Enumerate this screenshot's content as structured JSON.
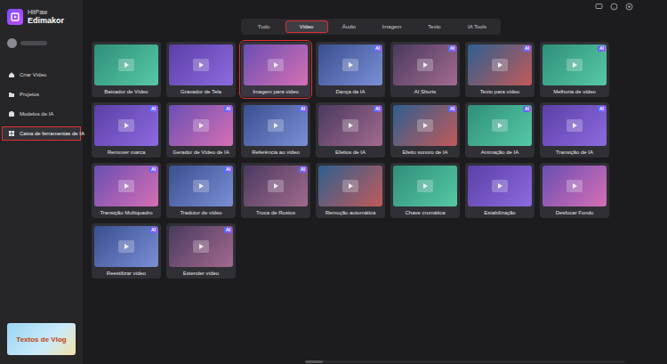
{
  "app": {
    "brand_top": "HitPaw",
    "brand_bottom": "Edimakor"
  },
  "sidebar": {
    "items": [
      {
        "label": "Criar Vídeo",
        "selected": false
      },
      {
        "label": "Projetos",
        "selected": false
      },
      {
        "label": "Modelos de IA",
        "selected": false
      },
      {
        "label": "Caixa de ferramentas de IA",
        "selected": true
      }
    ]
  },
  "promo": {
    "text": "Textos de Vlog"
  },
  "tabs": [
    {
      "label": "Tudo",
      "selected": false
    },
    {
      "label": "Vídeo",
      "selected": true
    },
    {
      "label": "Áudio",
      "selected": false
    },
    {
      "label": "Imagem",
      "selected": false
    },
    {
      "label": "Texto",
      "selected": false
    },
    {
      "label": "IA Tools",
      "selected": false
    }
  ],
  "tools": [
    {
      "label": "Baixador de Vídeo",
      "badge": null,
      "selected": false
    },
    {
      "label": "Gravador de Tela",
      "badge": null,
      "selected": false
    },
    {
      "label": "Imagem para vídeo",
      "badge": null,
      "selected": true
    },
    {
      "label": "Dança da IA",
      "badge": "AI",
      "selected": false
    },
    {
      "label": "AI Shorts",
      "badge": "AI",
      "selected": false
    },
    {
      "label": "Texto para vídeo",
      "badge": "AI",
      "selected": false
    },
    {
      "label": "Melhoria de vídeo",
      "badge": "AI",
      "selected": false
    },
    {
      "label": "Remover marca",
      "badge": "AI",
      "selected": false
    },
    {
      "label": "Gerador de Vídeo de IA",
      "badge": "AI",
      "selected": false
    },
    {
      "label": "Referência ao vídeo",
      "badge": "AI",
      "selected": false
    },
    {
      "label": "Efeitos de IA",
      "badge": "AI",
      "selected": false
    },
    {
      "label": "Efeito sonoro de IA",
      "badge": "AI",
      "selected": false
    },
    {
      "label": "Animação de IA",
      "badge": "AI",
      "selected": false
    },
    {
      "label": "Transição de IA",
      "badge": "AI",
      "selected": false
    },
    {
      "label": "Transição Multiquadro",
      "badge": "AI",
      "selected": false
    },
    {
      "label": "Tradutor de vídeo",
      "badge": "AI",
      "selected": false
    },
    {
      "label": "Troca de Rostos",
      "badge": "AI",
      "selected": false
    },
    {
      "label": "Remoção automática",
      "badge": null,
      "selected": false
    },
    {
      "label": "Chave cromática",
      "badge": null,
      "selected": false
    },
    {
      "label": "Estabilização",
      "badge": null,
      "selected": false
    },
    {
      "label": "Desfocar Fundo",
      "badge": null,
      "selected": false
    },
    {
      "label": "Reestilizar vídeo",
      "badge": "AI",
      "selected": false
    },
    {
      "label": "Estender vídeo",
      "badge": "AI",
      "selected": false
    }
  ]
}
